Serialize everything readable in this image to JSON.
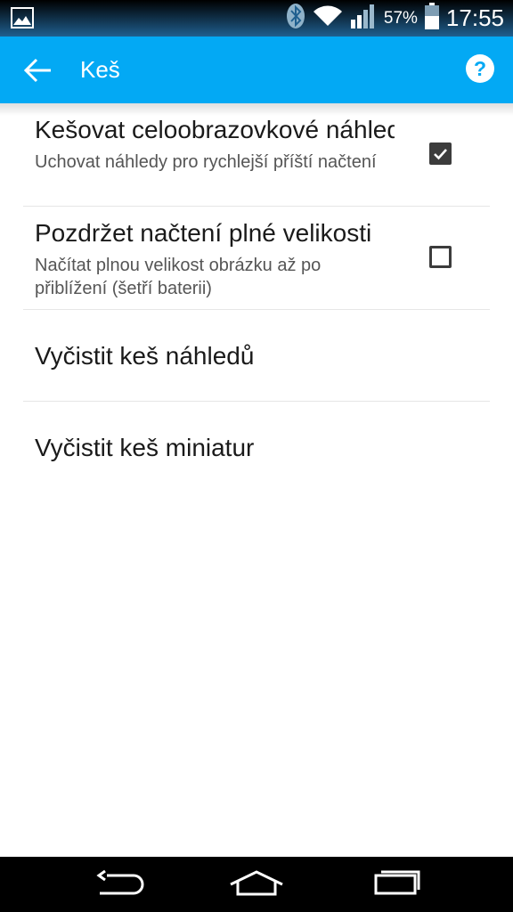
{
  "status_bar": {
    "battery": "57%",
    "time": "17:55",
    "icons": [
      "image-notification-icon",
      "bluetooth-icon",
      "wifi-icon",
      "signal-icon",
      "battery-icon"
    ]
  },
  "app_bar": {
    "title": "Keš",
    "back_icon": "arrow-back-icon",
    "help_icon": "help-icon",
    "color": "#03a9f4"
  },
  "preferences": [
    {
      "title": "Kešovat celoobrazovkové náhledy",
      "summary": "Uchovat náhledy pro rychlejší příští načtení",
      "checked": true
    },
    {
      "title": "Pozdržet načtení plné velikosti",
      "summary": "Načítat plnou velikost obrázku až po přiblížení (šetří baterii)",
      "checked": false
    },
    {
      "title": "Vyčistit keš náhledů"
    },
    {
      "title": "Vyčistit keš miniatur"
    }
  ],
  "nav_bar": {
    "icons": [
      "back-nav-icon",
      "home-icon",
      "recents-icon"
    ]
  }
}
